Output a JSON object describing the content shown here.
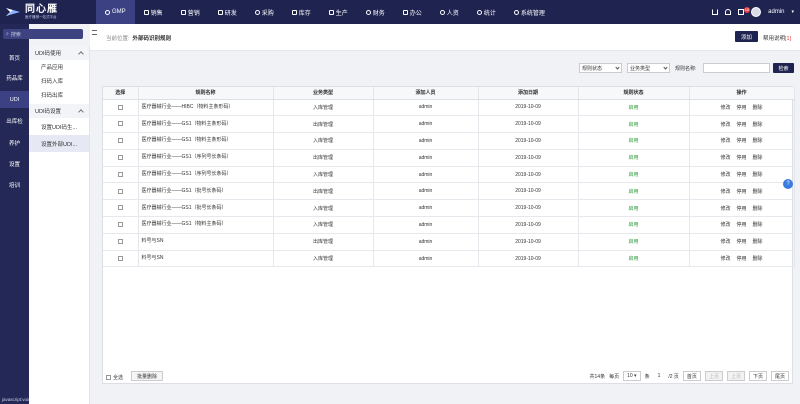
{
  "brand": {
    "title": "同心雁",
    "subtitle": "医疗器械一站式平台"
  },
  "nav": [
    {
      "label": "GMP",
      "active": true
    },
    {
      "label": "销售"
    },
    {
      "label": "营销"
    },
    {
      "label": "研发"
    },
    {
      "label": "采购"
    },
    {
      "label": "库存"
    },
    {
      "label": "生产"
    },
    {
      "label": "财务"
    },
    {
      "label": "办公"
    },
    {
      "label": "人资"
    },
    {
      "label": "统计"
    },
    {
      "label": "系统管理"
    }
  ],
  "top_right": {
    "user": "admin",
    "badge": "10"
  },
  "sidebar": {
    "search_placeholder": "搜索",
    "items": [
      {
        "label": "首页"
      },
      {
        "label": "药品库"
      },
      {
        "label": "UDI",
        "active": true
      },
      {
        "label": "出库检"
      },
      {
        "label": "养护"
      },
      {
        "label": "设置"
      },
      {
        "label": "培训"
      }
    ],
    "footer": "javascript:void(0)"
  },
  "submenu": {
    "groups": [
      {
        "label": "UDI码使用",
        "items": [
          "产品应用",
          "扫码入库",
          "扫码出库"
        ]
      },
      {
        "label": "UDI码设置",
        "items": [
          "设置UDI码生...",
          "设置外部UDI..."
        ]
      }
    ]
  },
  "breadcrumb": {
    "prefix": "当前位置:",
    "current": "外部码识别规则"
  },
  "actions": {
    "add": "添加",
    "help": "帮用说明",
    "help_count": "[1]"
  },
  "filters": {
    "status": "规则状态",
    "business": "业务类型",
    "name_label": "规则名称:",
    "search_button": "检索"
  },
  "table": {
    "headers": [
      "选择",
      "规则名称",
      "业务类型",
      "添加人员",
      "添加日期",
      "规则状态",
      "操作"
    ],
    "ops": [
      "修改",
      "停用",
      "删除"
    ],
    "rows": [
      {
        "name": "医疗器械行业——HIBC（物料主条形码）",
        "type": "入库管理",
        "user": "admin",
        "date": "2019-10-09",
        "status": "启用"
      },
      {
        "name": "医疗器械行业——GS1（物料主条形码）",
        "type": "出库管理",
        "user": "admin",
        "date": "2019-10-09",
        "status": "启用"
      },
      {
        "name": "医疗器械行业——GS1（物料主条形码）",
        "type": "入库管理",
        "user": "admin",
        "date": "2019-10-09",
        "status": "启用"
      },
      {
        "name": "医疗器械行业——GS1（序列号长条码）",
        "type": "出库管理",
        "user": "admin",
        "date": "2019-10-09",
        "status": "启用"
      },
      {
        "name": "医疗器械行业——GS1（序列号长条码）",
        "type": "入库管理",
        "user": "admin",
        "date": "2019-10-09",
        "status": "启用"
      },
      {
        "name": "医疗器械行业——GS1（批号长条码）",
        "type": "出库管理",
        "user": "admin",
        "date": "2019-10-09",
        "status": "启用"
      },
      {
        "name": "医疗器械行业——GS1（批号长条码）",
        "type": "入库管理",
        "user": "admin",
        "date": "2019-10-09",
        "status": "启用"
      },
      {
        "name": "医疗器械行业——GS1（物料主条码）",
        "type": "入库管理",
        "user": "admin",
        "date": "2019-10-09",
        "status": "启用"
      },
      {
        "name": "料号与SN",
        "type": "出库管理",
        "user": "admin",
        "date": "2019-10-09",
        "status": "启用"
      },
      {
        "name": "料号与SN",
        "type": "入库管理",
        "user": "admin",
        "date": "2019-10-09",
        "status": "启用"
      }
    ]
  },
  "footer": {
    "select_all": "全选",
    "bulk_delete": "批量删除",
    "total": "共14条",
    "per_page_label": "每页",
    "per_page": "10",
    "unit": "条",
    "page": "1",
    "pages": "/2 页",
    "home": "首页",
    "prev": "上页",
    "prev2": "上页",
    "next": "下页",
    "last": "尾页"
  }
}
